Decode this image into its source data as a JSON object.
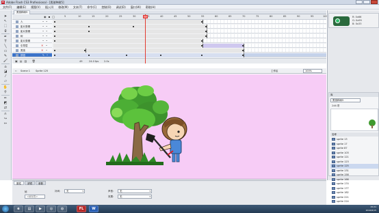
{
  "window": {
    "title": "Adobe Flash CS3 Professional - [男孩种树5]",
    "app_icon": "Fl"
  },
  "menu": [
    "文件(F)",
    "编辑(E)",
    "视图(V)",
    "插入(I)",
    "修改(M)",
    "文本(T)",
    "命令(C)",
    "控制(O)",
    "调试(D)",
    "窗口(W)",
    "帮助(H)"
  ],
  "document_tab": "男孩种树5",
  "timeline": {
    "frame_numbers": [
      "5",
      "10",
      "15",
      "20",
      "25",
      "30",
      "35",
      "40",
      "45",
      "50",
      "55",
      "60",
      "65",
      "70",
      "75",
      "80",
      "85",
      "90",
      "95",
      "100"
    ],
    "layers": [
      {
        "name": "人"
      },
      {
        "name": "影片剪辑"
      },
      {
        "name": "影片剪辑"
      },
      {
        "name": "树"
      },
      {
        "name": "影片剪辑"
      },
      {
        "name": "引导层"
      },
      {
        "name": "男孩"
      },
      {
        "name": "按钮"
      }
    ],
    "footer": {
      "current_frame": "49",
      "fps": "24.0 fps",
      "time": "2.0s"
    }
  },
  "scene": {
    "scene_label": "Scene 1",
    "symbol_label": "Sprite 125",
    "workspace_label": "工作区",
    "zoom": "100%"
  },
  "properties": {
    "tabs": [
      "属性",
      "滤镜",
      "参数"
    ],
    "frame_label": "帧",
    "frame_placeholder": "<帧标签>",
    "tween_label": "补间:",
    "tween_value": "无",
    "sound_label": "声音:",
    "sound_value": "无",
    "effect_label": "效果:",
    "effect_value": "无"
  },
  "color_panel": {
    "line1": "R: 0x66",
    "line2": "G: 0x99",
    "line3": "B: 0x33"
  },
  "library": {
    "header": "库",
    "document": "男孩种树5",
    "count": "246 项",
    "column": "名称",
    "items": [
      {
        "name": "sprite 13"
      },
      {
        "name": "sprite 17"
      },
      {
        "name": "sprite 87"
      },
      {
        "name": "sprite 103"
      },
      {
        "name": "sprite 121"
      },
      {
        "name": "sprite 123"
      },
      {
        "name": "sprite 125",
        "selected": true
      },
      {
        "name": "sprite 131"
      },
      {
        "name": "sprite 158"
      },
      {
        "name": "sprite 166"
      },
      {
        "name": "sprite 174"
      },
      {
        "name": "sprite 177"
      },
      {
        "name": "sprite 182"
      },
      {
        "name": "sprite 221"
      },
      {
        "name": "sprite 224"
      }
    ]
  },
  "taskbar": {
    "buttons": [
      "FL",
      "W"
    ],
    "clock_time": "15:21",
    "clock_date": "2016/6/15"
  },
  "colors": {
    "stage_bg": "#f7ccf6",
    "selected_layer": "#3b73c9",
    "playhead": "#e23a2f"
  }
}
